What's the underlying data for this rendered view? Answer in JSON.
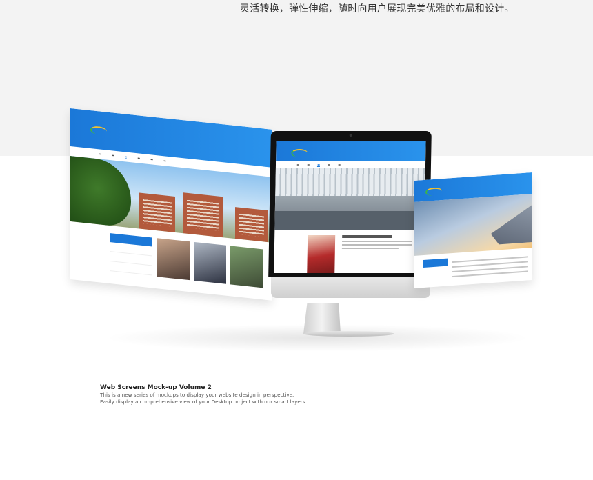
{
  "headline": "灵活转换，弹性伸缩，随时向用户展现完美优雅的布局和设计。",
  "mockup": {
    "title": "Web Screens Mock-up Volume 2",
    "line1": "This is a new series of mockups to display your website design in perspective.",
    "line2": "Easily display a comprehensive view of your Desktop project with our smart layers."
  },
  "colors": {
    "brand_blue": "#1b78d8",
    "band_gray": "#f3f3f3",
    "airport_gray": "#9ba5ad",
    "sunset": "#f2c27a"
  }
}
